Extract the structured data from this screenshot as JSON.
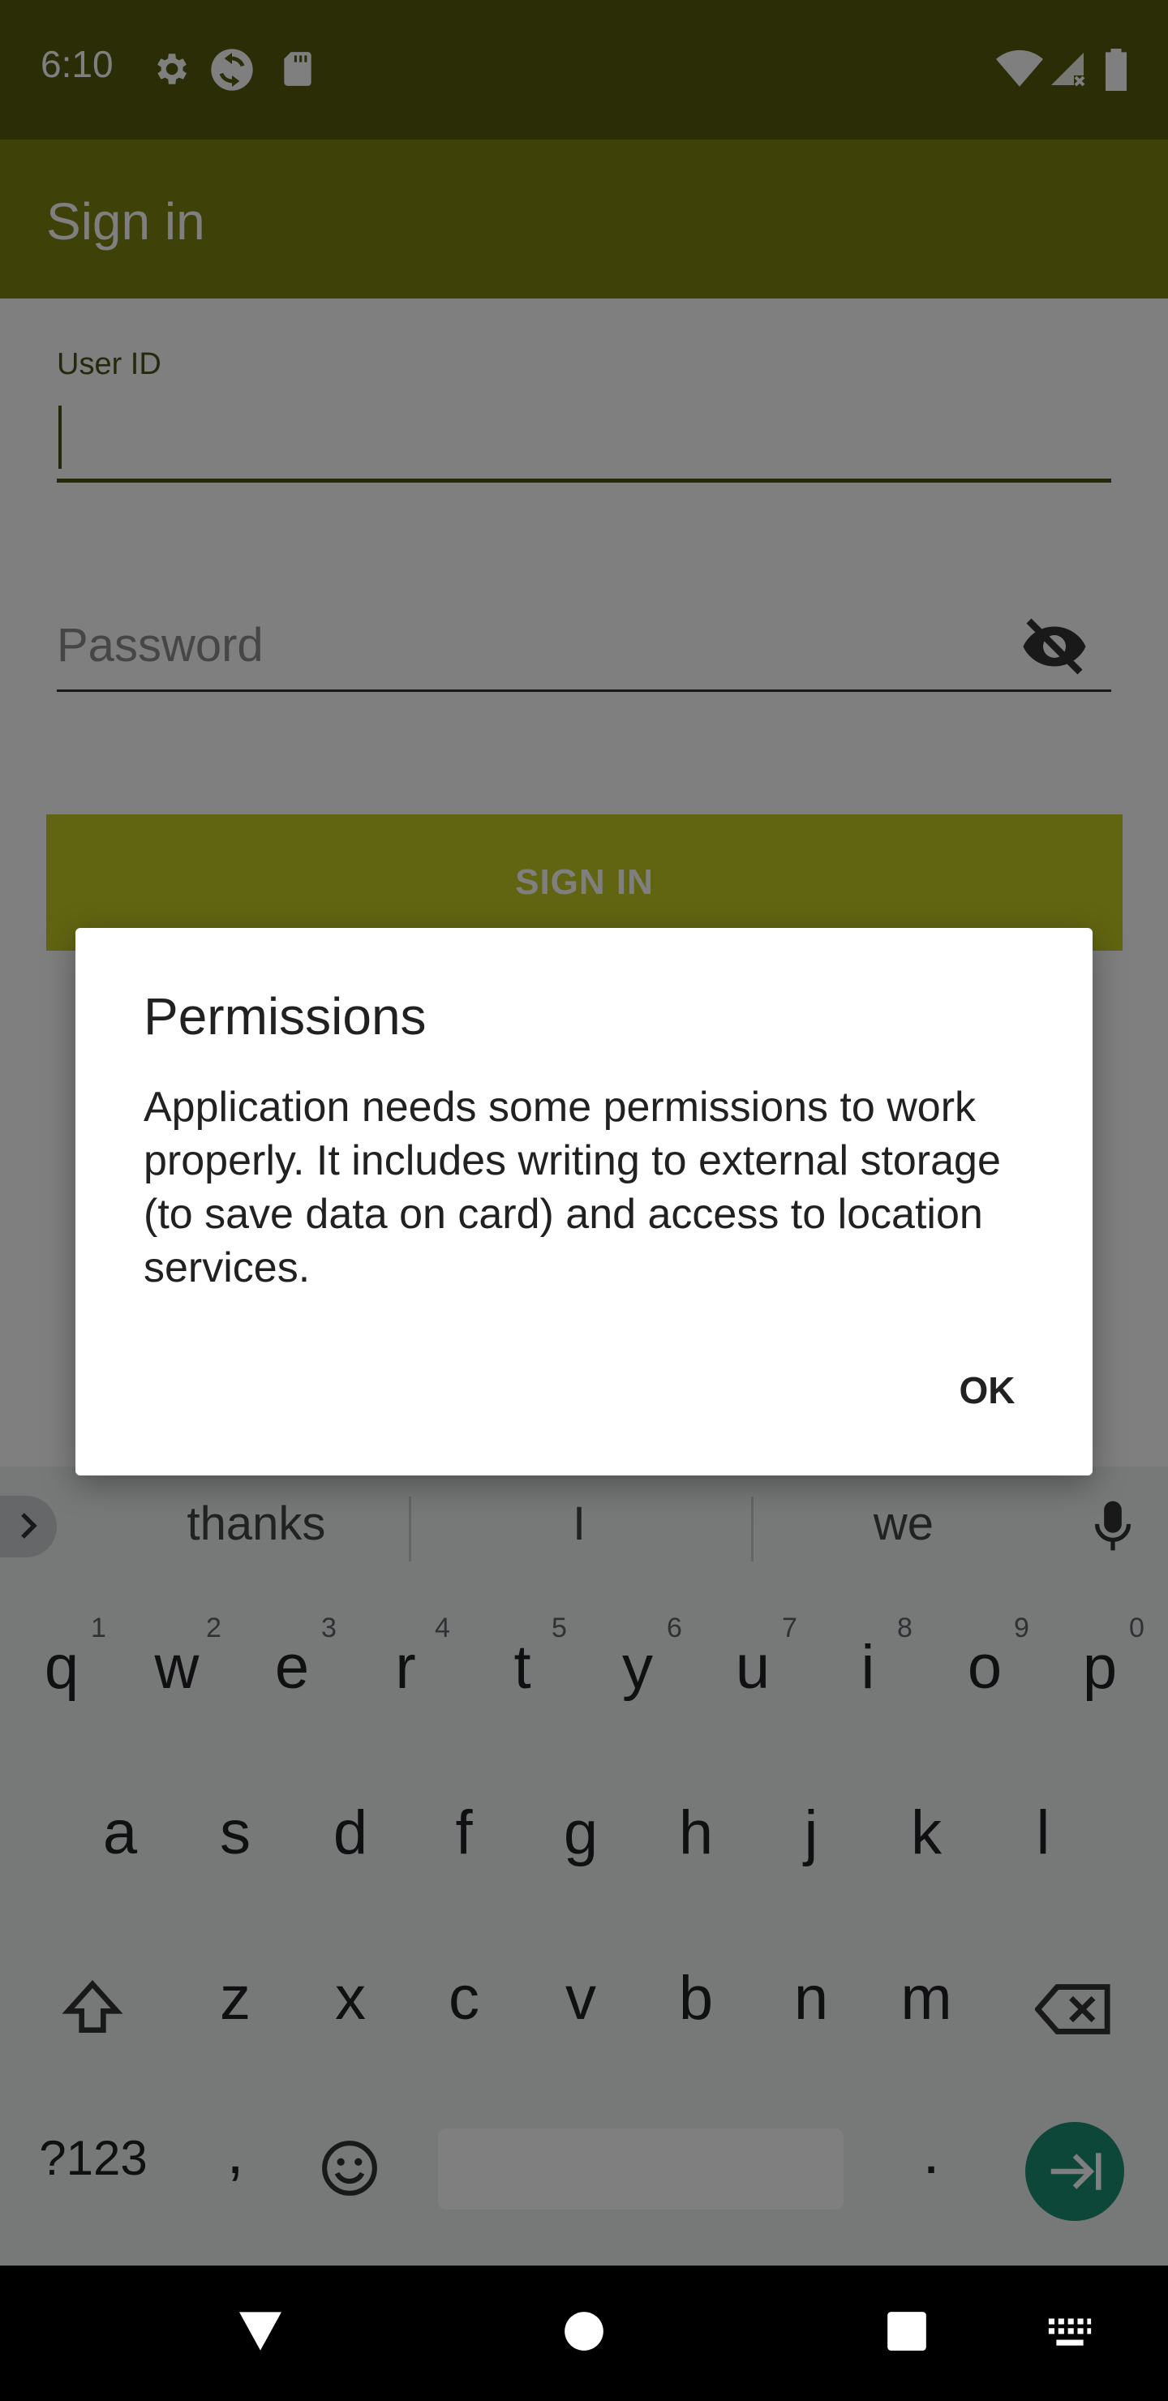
{
  "status_bar": {
    "time": "6:10",
    "icons": [
      "gear-icon",
      "sync-icon",
      "sd-card-icon",
      "wifi-icon",
      "signal-icon",
      "battery-icon"
    ]
  },
  "app_bar": {
    "title": "Sign in"
  },
  "form": {
    "userid_label": "User ID",
    "userid_value": "",
    "password_placeholder": "Password",
    "signin_label": "SIGN IN"
  },
  "dialog": {
    "title": "Permissions",
    "message": "Application needs some permissions to work properly. It includes writing to external storage (to save data on card) and access to location services.",
    "ok_label": "OK"
  },
  "keyboard": {
    "suggestions": [
      "thanks",
      "I",
      "we"
    ],
    "row1": [
      "q",
      "w",
      "e",
      "r",
      "t",
      "y",
      "u",
      "i",
      "o",
      "p"
    ],
    "row1_hints": [
      "1",
      "2",
      "3",
      "4",
      "5",
      "6",
      "7",
      "8",
      "9",
      "0"
    ],
    "row2": [
      "a",
      "s",
      "d",
      "f",
      "g",
      "h",
      "j",
      "k",
      "l"
    ],
    "row3": [
      "z",
      "x",
      "c",
      "v",
      "b",
      "n",
      "m"
    ],
    "symbols_label": "?123",
    "comma": ",",
    "period": "."
  },
  "colors": {
    "status_bar": "#575a0e",
    "app_bar": "#7d8512",
    "accent": "#c3cb23",
    "enter_key": "#1a8e74"
  }
}
